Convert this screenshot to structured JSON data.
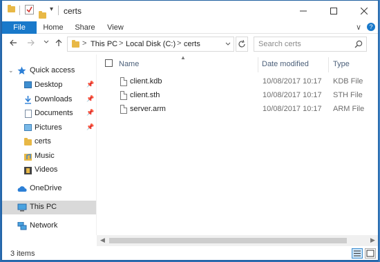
{
  "window": {
    "title": "certs",
    "minimize_icon": "minimize-icon",
    "maximize_icon": "maximize-icon",
    "close_icon": "close-icon"
  },
  "quick_access_toolbar": {
    "customize_label": "▾"
  },
  "ribbon": {
    "tabs": [
      {
        "label": "File"
      },
      {
        "label": "Home"
      },
      {
        "label": "Share"
      },
      {
        "label": "View"
      }
    ],
    "expand_label": "∨",
    "help_label": "?"
  },
  "address_bar": {
    "crumbs": [
      "This PC",
      "Local Disk (C:)",
      "certs"
    ],
    "separator": ">"
  },
  "search": {
    "placeholder": "Search certs"
  },
  "nav_pane": {
    "items": [
      {
        "label": "Quick access",
        "icon": "star-icon"
      },
      {
        "label": "Desktop",
        "icon": "desktop-folder-icon",
        "pinned": true
      },
      {
        "label": "Downloads",
        "icon": "downloads-folder-icon",
        "pinned": true
      },
      {
        "label": "Documents",
        "icon": "documents-folder-icon",
        "pinned": true
      },
      {
        "label": "Pictures",
        "icon": "pictures-folder-icon",
        "pinned": true
      },
      {
        "label": "certs",
        "icon": "folder-icon"
      },
      {
        "label": "Music",
        "icon": "music-folder-icon"
      },
      {
        "label": "Videos",
        "icon": "videos-folder-icon"
      },
      {
        "label": "OneDrive",
        "icon": "onedrive-cloud-icon"
      },
      {
        "label": "This PC",
        "icon": "computer-icon",
        "selected": true
      },
      {
        "label": "Network",
        "icon": "network-icon"
      }
    ]
  },
  "columns": {
    "name": "Name",
    "date_modified": "Date modified",
    "type": "Type"
  },
  "files": [
    {
      "name": "client.kdb",
      "date": "10/08/2017 10:17",
      "type": "KDB File"
    },
    {
      "name": "client.sth",
      "date": "10/08/2017 10:17",
      "type": "STH File"
    },
    {
      "name": "server.arm",
      "date": "10/08/2017 10:17",
      "type": "ARM File"
    }
  ],
  "status": {
    "item_count": "3 items"
  },
  "colors": {
    "accent": "#1979ca",
    "selection": "#d9d9d9",
    "folder": "#e8b846"
  }
}
